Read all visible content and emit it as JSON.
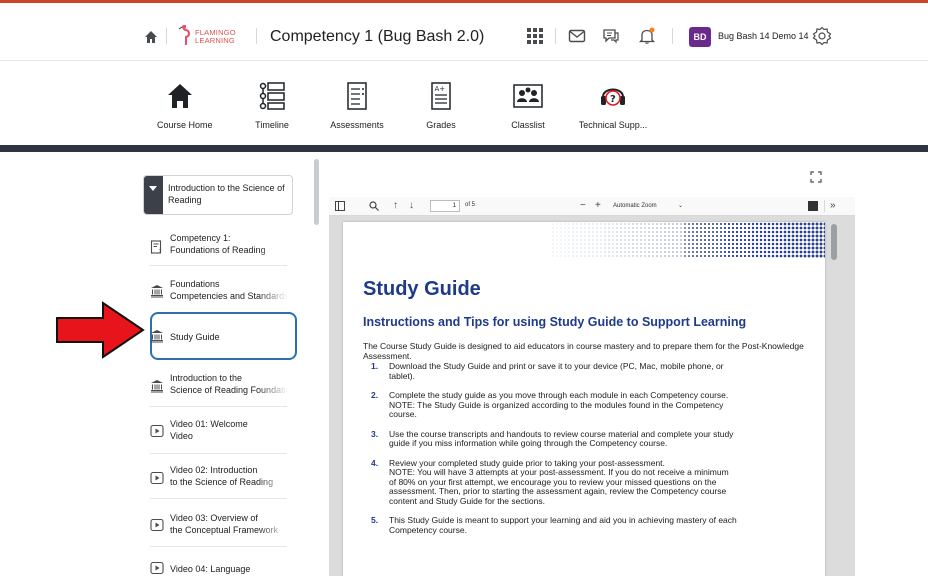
{
  "header": {
    "logo_line1": "FLAMINGO",
    "logo_line2": "LEARNING",
    "course_title": "Competency 1 (Bug Bash 2.0)",
    "user_initials": "BD",
    "user_name": "Bug Bash 14 Demo 14",
    "icons": [
      "home-icon",
      "waffle-icon",
      "mail-icon",
      "chat-icon",
      "bell-icon",
      "gear-icon"
    ],
    "notification_color": "#f58220"
  },
  "navbar": {
    "items": [
      {
        "label": "Course Home",
        "icon": "home-icon"
      },
      {
        "label": "Timeline",
        "icon": "timeline-icon"
      },
      {
        "label": "Assessments",
        "icon": "assessments-icon"
      },
      {
        "label": "Grades",
        "icon": "grades-icon"
      },
      {
        "label": "Classlist",
        "icon": "classlist-icon"
      },
      {
        "label": "Technical Supp...",
        "icon": "headset-help-icon"
      }
    ]
  },
  "sidebar": {
    "module_title": "Introduction to the Science of Reading",
    "topics": [
      {
        "label": "Competency 1: Foundations of Reading",
        "line1": "Competency 1:",
        "line2": "Foundations of Reading",
        "icon": "quiz-icon"
      },
      {
        "label": "Foundations Competencies and Standards",
        "line1": "Foundations",
        "line2": "Competencies and Standards",
        "icon": "institution-icon"
      },
      {
        "label": "Study Guide",
        "icon": "institution-icon",
        "selected": true
      },
      {
        "label": "Introduction to the Science of Reading Foundations",
        "line1": "Introduction to the",
        "line2": "Science of Reading Foundations",
        "icon": "institution-icon"
      },
      {
        "label": "Video 01: Welcome Video",
        "line1": "Video 01: Welcome",
        "line2": "Video",
        "icon": "video-icon"
      },
      {
        "label": "Video 02: Introduction to the Science of Reading",
        "line1": "Video 02: Introduction",
        "line2": "to the Science of Reading",
        "icon": "video-icon"
      },
      {
        "label": "Video 03: Overview of the Conceptual Framework",
        "line1": "Video 03: Overview of",
        "line2": "the Conceptual Framework",
        "icon": "video-icon"
      },
      {
        "label": "Video 04: Language",
        "icon": "video-icon"
      }
    ],
    "highlight_color": "#2f6fb0",
    "arrow_color": "#e8141c"
  },
  "pdf": {
    "page_number": "1",
    "page_count": "of 5",
    "zoom": "Automatic Zoom",
    "title": "Study Guide",
    "subtitle": "Instructions and Tips for using Study Guide to Support Learning",
    "intro": "The Course Study Guide is designed to aid educators in course mastery and to prepare them for the Post-Knowledge Assessment.",
    "steps": [
      {
        "num": "1.",
        "text": "Download the Study Guide and print or save it to your device (PC, Mac, mobile phone, or\ntablet)."
      },
      {
        "num": "2.",
        "text": "Complete the study guide as you move through each module in each Competency course.\nNOTE: The Study Guide is organized according to the modules found in the Competency\ncourse."
      },
      {
        "num": "3.",
        "text": "Use the course transcripts and handouts to review course material and complete your study\nguide if you miss information while going through the Competency course."
      },
      {
        "num": "4.",
        "text": "Review your completed study guide prior to taking your post-assessment.\nNOTE: You will have 3 attempts at your post-assessment. If you do not receive a minimum\nof 80% on your first attempt, we encourage you to review your missed questions on the\nassessment. Then, prior to starting the assessment again, review the Competency course\ncontent and Study Guide for the sections."
      },
      {
        "num": "5.",
        "text": "This Study Guide is meant to support your learning and aid you in achieving mastery of each\nCompetency course."
      }
    ],
    "heading_color": "#1e3a8a"
  }
}
